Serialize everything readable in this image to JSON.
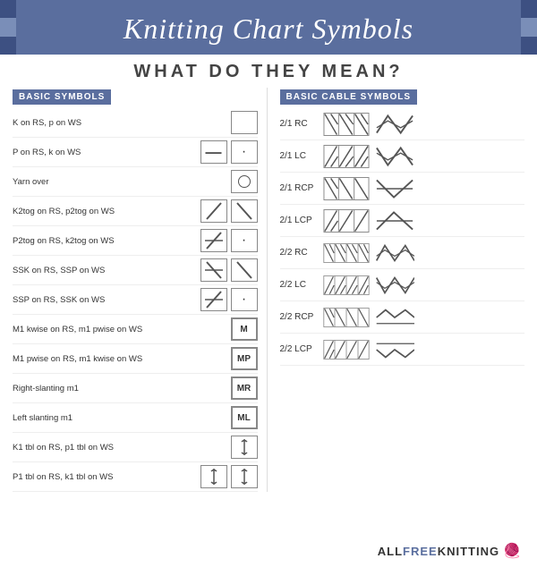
{
  "header": {
    "title": "Knitting Chart Symbols",
    "subtitle": "WHAT DO THEY MEAN?"
  },
  "left_section": {
    "header": "BASIC SYMBOLS",
    "rows": [
      {
        "label": "K on RS, p on WS",
        "sym1": "empty",
        "sym2": null
      },
      {
        "label": "P on RS, k on WS",
        "sym1": "hline",
        "sym2": "dot"
      },
      {
        "label": "Yarn over",
        "sym1": null,
        "sym2": "circle"
      },
      {
        "label": "K2tog on RS, p2tog on WS",
        "sym1": "slash-l",
        "sym2": "slash-r"
      },
      {
        "label": "P2tog on RS, k2tog on WS",
        "sym1": "slash-bl",
        "sym2": "dot"
      },
      {
        "label": "SSK on RS, SSP on WS",
        "sym1": "slash-r2",
        "sym2": "slash-r3"
      },
      {
        "label": "SSP on RS, SSK on WS",
        "sym1": "slash-bl2",
        "sym2": "dot2"
      },
      {
        "label": "M1 kwise on RS, m1 pwise on WS",
        "sym1": "M",
        "sym2": null
      },
      {
        "label": "M1 pwise on RS, m1 kwise on WS",
        "sym1": "MP",
        "sym2": null
      },
      {
        "label": "Right-slanting m1",
        "sym1": "MR",
        "sym2": null
      },
      {
        "label": "Left slanting m1",
        "sym1": "ML",
        "sym2": null
      },
      {
        "label": "K1 tbl on RS, p1 tbl on WS",
        "sym1": "tbl",
        "sym2": null
      },
      {
        "label": "P1 tbl on RS, k1 tbl on WS",
        "sym1": "tbl2",
        "sym2": "tbl3"
      }
    ]
  },
  "right_section": {
    "header": "BASIC CABLE SYMBOLS",
    "rows": [
      {
        "label": "2/1 RC"
      },
      {
        "label": "2/1 LC"
      },
      {
        "label": "2/1 RCP"
      },
      {
        "label": "2/1 LCP"
      },
      {
        "label": "2/2 RC"
      },
      {
        "label": "2/2 LC"
      },
      {
        "label": "2/2 RCP"
      },
      {
        "label": "2/2 LCP"
      }
    ]
  },
  "footer": {
    "brand": "ALLFREEKNITTING"
  }
}
